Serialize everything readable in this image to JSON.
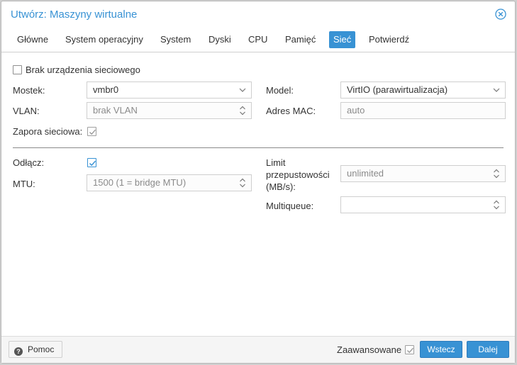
{
  "window": {
    "title": "Utwórz: Maszyny wirtualne"
  },
  "tabs": [
    {
      "label": "Główne"
    },
    {
      "label": "System operacyjny"
    },
    {
      "label": "System"
    },
    {
      "label": "Dyski"
    },
    {
      "label": "CPU"
    },
    {
      "label": "Pamięć"
    },
    {
      "label": "Sieć",
      "active": true
    },
    {
      "label": "Potwierdź"
    }
  ],
  "network": {
    "no_device_label": "Brak urządzenia sieciowego",
    "no_device_checked": false,
    "bridge_label": "Mostek:",
    "bridge_value": "vmbr0",
    "vlan_label": "VLAN:",
    "vlan_value": "brak VLAN",
    "firewall_label": "Zapora sieciowa:",
    "firewall_checked": true,
    "model_label": "Model:",
    "model_value": "VirtIO (parawirtualizacja)",
    "mac_label": "Adres MAC:",
    "mac_value": "auto",
    "disconnect_label": "Odłącz:",
    "disconnect_checked": true,
    "mtu_label": "MTU:",
    "mtu_value": "1500 (1 = bridge MTU)",
    "rate_label_line1": "Limit",
    "rate_label_line2": "przepustowości",
    "rate_label_line3": "(MB/s):",
    "rate_value": "unlimited",
    "multiqueue_label": "Multiqueue:",
    "multiqueue_value": ""
  },
  "footer": {
    "help_label": "Pomoc",
    "advanced_label": "Zaawansowane",
    "advanced_checked": true,
    "back_label": "Wstecz",
    "next_label": "Dalej"
  },
  "colors": {
    "accent": "#3892d4",
    "border": "#cfcfcf",
    "disabled_text": "#8a8a8a"
  }
}
